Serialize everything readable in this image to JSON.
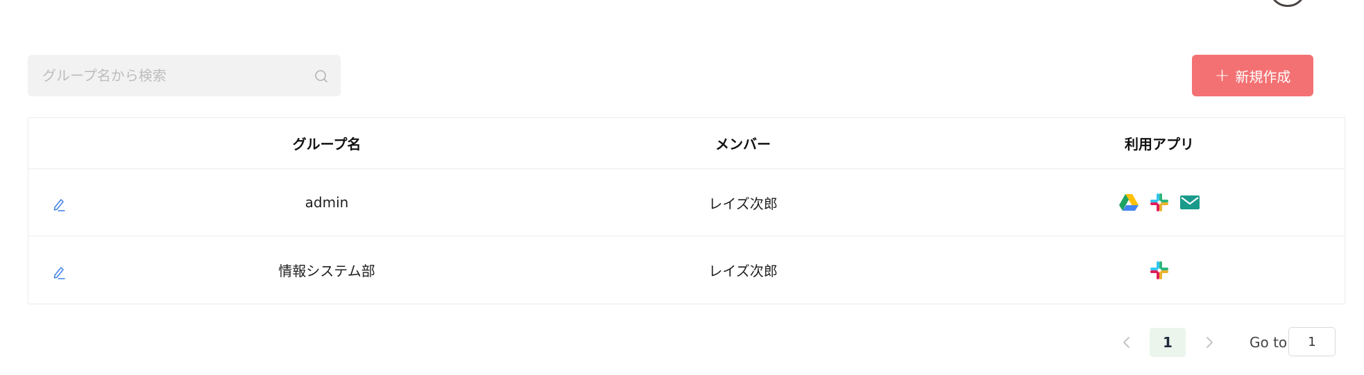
{
  "search": {
    "placeholder": "グループ名から検索",
    "value": ""
  },
  "toolbar": {
    "create_label": "新規作成"
  },
  "table": {
    "columns": [
      "グループ名",
      "メンバー",
      "利用アプリ"
    ],
    "rows": [
      {
        "name": "admin",
        "member": "レイズ次郎",
        "apps": [
          "google-drive-icon",
          "slack-icon",
          "mail-icon"
        ]
      },
      {
        "name": "情報システム部",
        "member": "レイズ次郎",
        "apps": [
          "slack-icon"
        ]
      }
    ]
  },
  "pagination": {
    "current_page": "1",
    "goto_label": "Go to",
    "goto_value": "1"
  },
  "colors": {
    "accent": "#f37173",
    "page_active_bg": "#ebf5ec",
    "edit_icon": "#3d7fe6"
  }
}
